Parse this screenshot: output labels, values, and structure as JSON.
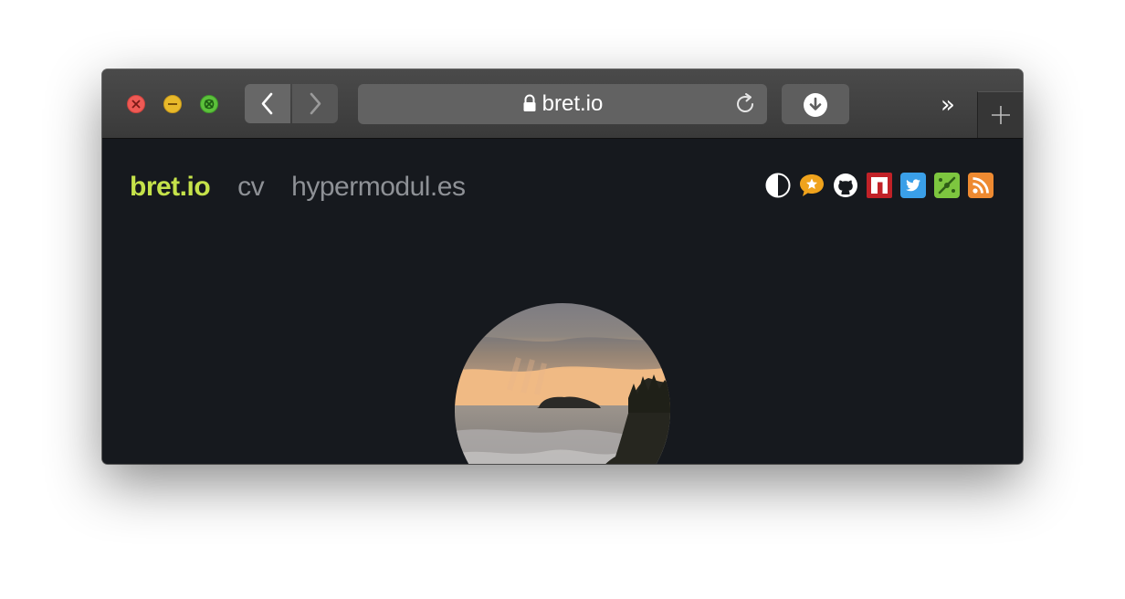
{
  "browser": {
    "address": "bret.io",
    "overflow_glyph": "»"
  },
  "site": {
    "brand": "bret.io",
    "links": [
      "cv",
      "hypermodul.es"
    ],
    "brand_color": "#c5e24a",
    "link_color": "#8e9196",
    "background": "#16191e",
    "social_icons": [
      "contrast-toggle-icon",
      "stars-icon",
      "github-icon",
      "npm-icon",
      "twitter-icon",
      "keybase-icon",
      "rss-icon"
    ]
  }
}
